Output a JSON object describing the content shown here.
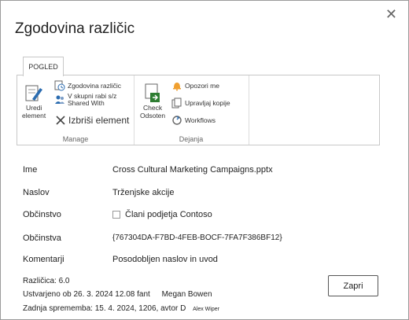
{
  "dialog": {
    "title": "Zgodovina različic",
    "close_glyph": "✕"
  },
  "ribbon": {
    "tab_label": "POGLED",
    "groups": {
      "manage": {
        "label": "Manage",
        "edit_label_1": "Uredi",
        "edit_label_2": "element",
        "version_history": "Zgodovina različic",
        "shared_with_1": "V skupni rabi s/z",
        "shared_with_2": "Shared With",
        "delete_item": "Izbriši element"
      },
      "actions": {
        "label": "Dejanja",
        "check_out_1": "Check",
        "check_out_2": "Odsoten",
        "alert_me": "Opozori me",
        "manage_copies": "Upravljaj kopije",
        "workflows": "Workflows"
      }
    }
  },
  "properties": [
    {
      "label": "Ime",
      "value": "Cross Cultural Marketing Campaigns.pptx"
    },
    {
      "label": "Naslov",
      "value": "Trženjske akcije"
    },
    {
      "label": "Občinstvo",
      "value": "Člani podjetja Contoso"
    },
    {
      "label": "Občinstva",
      "value": "{767304DA-F7BD-4FEB-BOCF-7FA7F386BF12}"
    },
    {
      "label": "Komentarji",
      "value": "Posodobljen naslov in uvod"
    }
  ],
  "footer": {
    "version": "Različica: 6.0",
    "created": "Ustvarjeno ob 26. 3. 2024 12.08 fant",
    "created_by": "Megan Bowen",
    "modified": "Zadnja sprememba: 15. 4. 2024, 1206, avtor D",
    "modified_by": "Alex Wiper"
  },
  "buttons": {
    "close": "Zapri"
  },
  "colors": {
    "accent_blue": "#2b6cb0",
    "border": "#c8c8c8"
  }
}
